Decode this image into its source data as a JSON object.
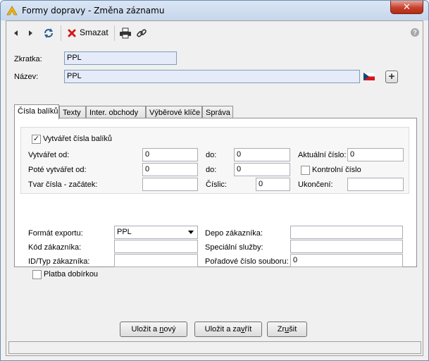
{
  "window": {
    "title": "Formy dopravy - Změna záznamu",
    "close_glyph": "✕"
  },
  "toolbar": {
    "delete_label": "Smazat",
    "prev_icon": "arrow-left-icon",
    "next_icon": "arrow-right-icon",
    "refresh_icon": "refresh-icon",
    "delete_icon": "delete-x-icon",
    "print_icon": "printer-icon",
    "link_icon": "link-icon",
    "help_glyph": "?"
  },
  "header": {
    "zkratka_label": "Zkratka:",
    "zkratka_value": "PPL",
    "nazev_label": "Název:",
    "nazev_value": "PPL",
    "add_glyph": "+"
  },
  "tabs": [
    {
      "label": "Čísla balíků",
      "active": true
    },
    {
      "label": "Texty",
      "active": false
    },
    {
      "label": "Inter. obchody",
      "active": false
    },
    {
      "label": "Výběrové klíče",
      "active": false
    },
    {
      "label": "Správa",
      "active": false
    }
  ],
  "package_numbers": {
    "create_numbers_label": "Vytvářet čísla balíků",
    "create_numbers_checked": true,
    "create_from_label": "Vytvářet od:",
    "create_from_value": "0",
    "do1_label": "do:",
    "do1_value": "0",
    "current_label": "Aktuální číslo:",
    "current_value": "0",
    "then_from_label": "Poté vytvářet od:",
    "then_from_value": "0",
    "do2_label": "do:",
    "do2_value": "0",
    "control_label": "Kontrolní číslo",
    "control_checked": false,
    "prefix_label": "Tvar čísla - začátek:",
    "prefix_value": "",
    "digits_label": "Číslic:",
    "digits_value": "0",
    "ending_label": "Ukončení:",
    "ending_value": ""
  },
  "export": {
    "format_label": "Formát exportu:",
    "format_value": "PPL",
    "customer_code_label": "Kód zákazníka:",
    "customer_code_value": "",
    "id_type_label": "ID/Typ zákazníka:",
    "id_type_value": "",
    "depot_label": "Depo zákazníka:",
    "depot_value": "",
    "special_label": "Speciální služby:",
    "special_value": "",
    "file_order_label": "Pořadové číslo souboru:",
    "file_order_value": "0",
    "cod_label": "Platba dobírkou",
    "cod_checked": false
  },
  "buttons": {
    "save_new_pre": "Uložit a ",
    "save_new_key": "n",
    "save_new_post": "ový",
    "save_close_pre": "Uložit a za",
    "save_close_key": "v",
    "save_close_post": "řít",
    "cancel_pre": "Zr",
    "cancel_key": "u",
    "cancel_post": "šit"
  },
  "colors": {
    "accent_field": "#e5ebf9",
    "delete_red": "#d11b1b"
  }
}
